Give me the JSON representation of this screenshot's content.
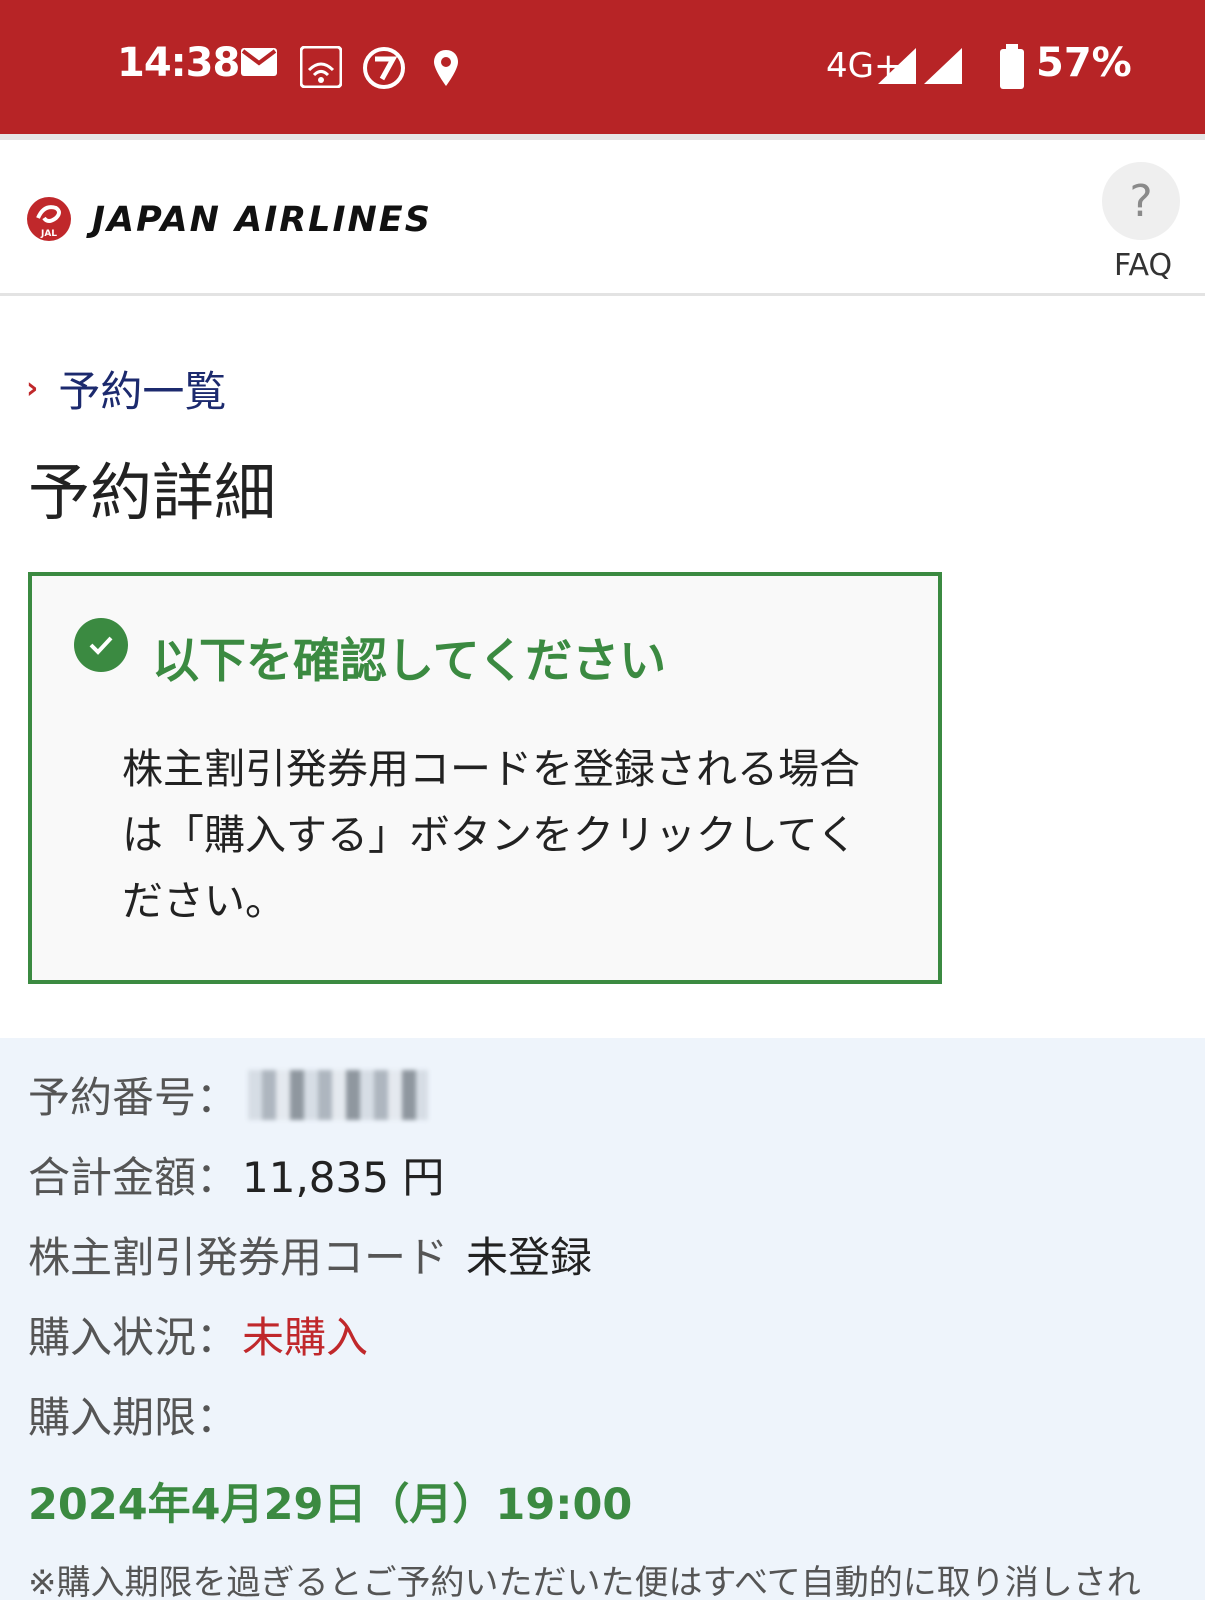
{
  "status_bar": {
    "time": "14:38",
    "network": "4G+",
    "battery": "57%",
    "icons": [
      "mail-icon",
      "au-wifi-icon",
      "seven-eleven-icon",
      "location-icon",
      "signal-icon",
      "battery-icon"
    ]
  },
  "header": {
    "brand": "JAPAN AIRLINES",
    "logo_text": "JAL",
    "faq_symbol": "?",
    "faq_label": "FAQ"
  },
  "breadcrumb": {
    "link": "予約一覧"
  },
  "page": {
    "title": "予約詳細"
  },
  "notice": {
    "title": "以下を確認してください",
    "body": "株主割引発券用コードを登録される場合は「購入する」ボタンをクリックしてください。"
  },
  "details": {
    "reservation_label": "予約番号：",
    "total_label": "合計金額：",
    "total_value": "11,835 円",
    "code_label": "株主割引発券用コード",
    "code_value": "未登録",
    "status_label": "購入状況：",
    "status_value": "未購入",
    "deadline_label": "購入期限：",
    "deadline_value": "2024年4月29日（月）19:00",
    "note": "※購入期限を過ぎるとご予約いただいた便はすべて自動的に取り消しされ"
  },
  "colors": {
    "status_bar": "#b72426",
    "accent_green": "#3b8a41",
    "accent_red": "#c0282b",
    "link_blue": "#1c2a6e",
    "details_bg": "#eef4fb"
  }
}
